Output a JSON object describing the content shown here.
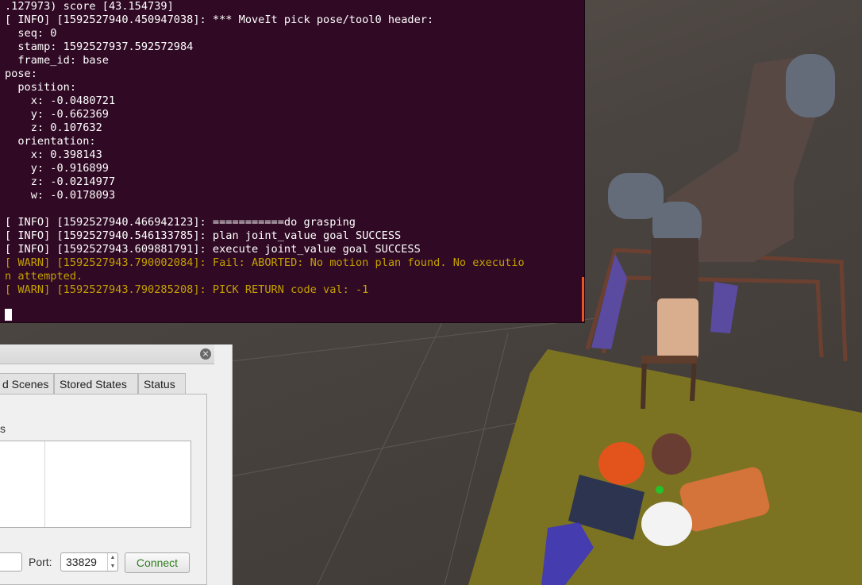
{
  "terminal": {
    "lines": [
      {
        "text": ".127973) score [43.154739]",
        "level": "info"
      },
      {
        "text": "[ INFO] [1592527940.450947038]: *** MoveIt pick pose/tool0 header:",
        "level": "info"
      },
      {
        "text": "  seq: 0",
        "level": "info"
      },
      {
        "text": "  stamp: 1592527937.592572984",
        "level": "info"
      },
      {
        "text": "  frame_id: base",
        "level": "info"
      },
      {
        "text": "pose:",
        "level": "info"
      },
      {
        "text": "  position:",
        "level": "info"
      },
      {
        "text": "    x: -0.0480721",
        "level": "info"
      },
      {
        "text": "    y: -0.662369",
        "level": "info"
      },
      {
        "text": "    z: 0.107632",
        "level": "info"
      },
      {
        "text": "  orientation:",
        "level": "info"
      },
      {
        "text": "    x: 0.398143",
        "level": "info"
      },
      {
        "text": "    y: -0.916899",
        "level": "info"
      },
      {
        "text": "    z: -0.0214977",
        "level": "info"
      },
      {
        "text": "    w: -0.0178093",
        "level": "info"
      },
      {
        "text": "",
        "level": "info"
      },
      {
        "text": "[ INFO] [1592527940.466942123]: ===========do grasping",
        "level": "info"
      },
      {
        "text": "[ INFO] [1592527940.546133785]: plan joint_value goal SUCCESS",
        "level": "info"
      },
      {
        "text": "[ INFO] [1592527943.609881791]: execute joint_value goal SUCCESS",
        "level": "info"
      },
      {
        "text": "[ WARN] [1592527943.790002084]: Fail: ABORTED: No motion plan found. No executio",
        "level": "warn"
      },
      {
        "text": "n attempted.",
        "level": "warn"
      },
      {
        "text": "[ WARN] [1592527943.790285208]: PICK RETURN code val: -1",
        "level": "warn"
      }
    ],
    "colors": {
      "background": "#300a24",
      "text": "#ffffff",
      "warn": "#c4a000"
    }
  },
  "panel": {
    "close_icon": "×",
    "tabs": [
      "d Scenes",
      "Stored States",
      "Status"
    ],
    "list_label": "s",
    "port_label": "Port:",
    "port_value": "33829",
    "connect_label": "Connect"
  }
}
